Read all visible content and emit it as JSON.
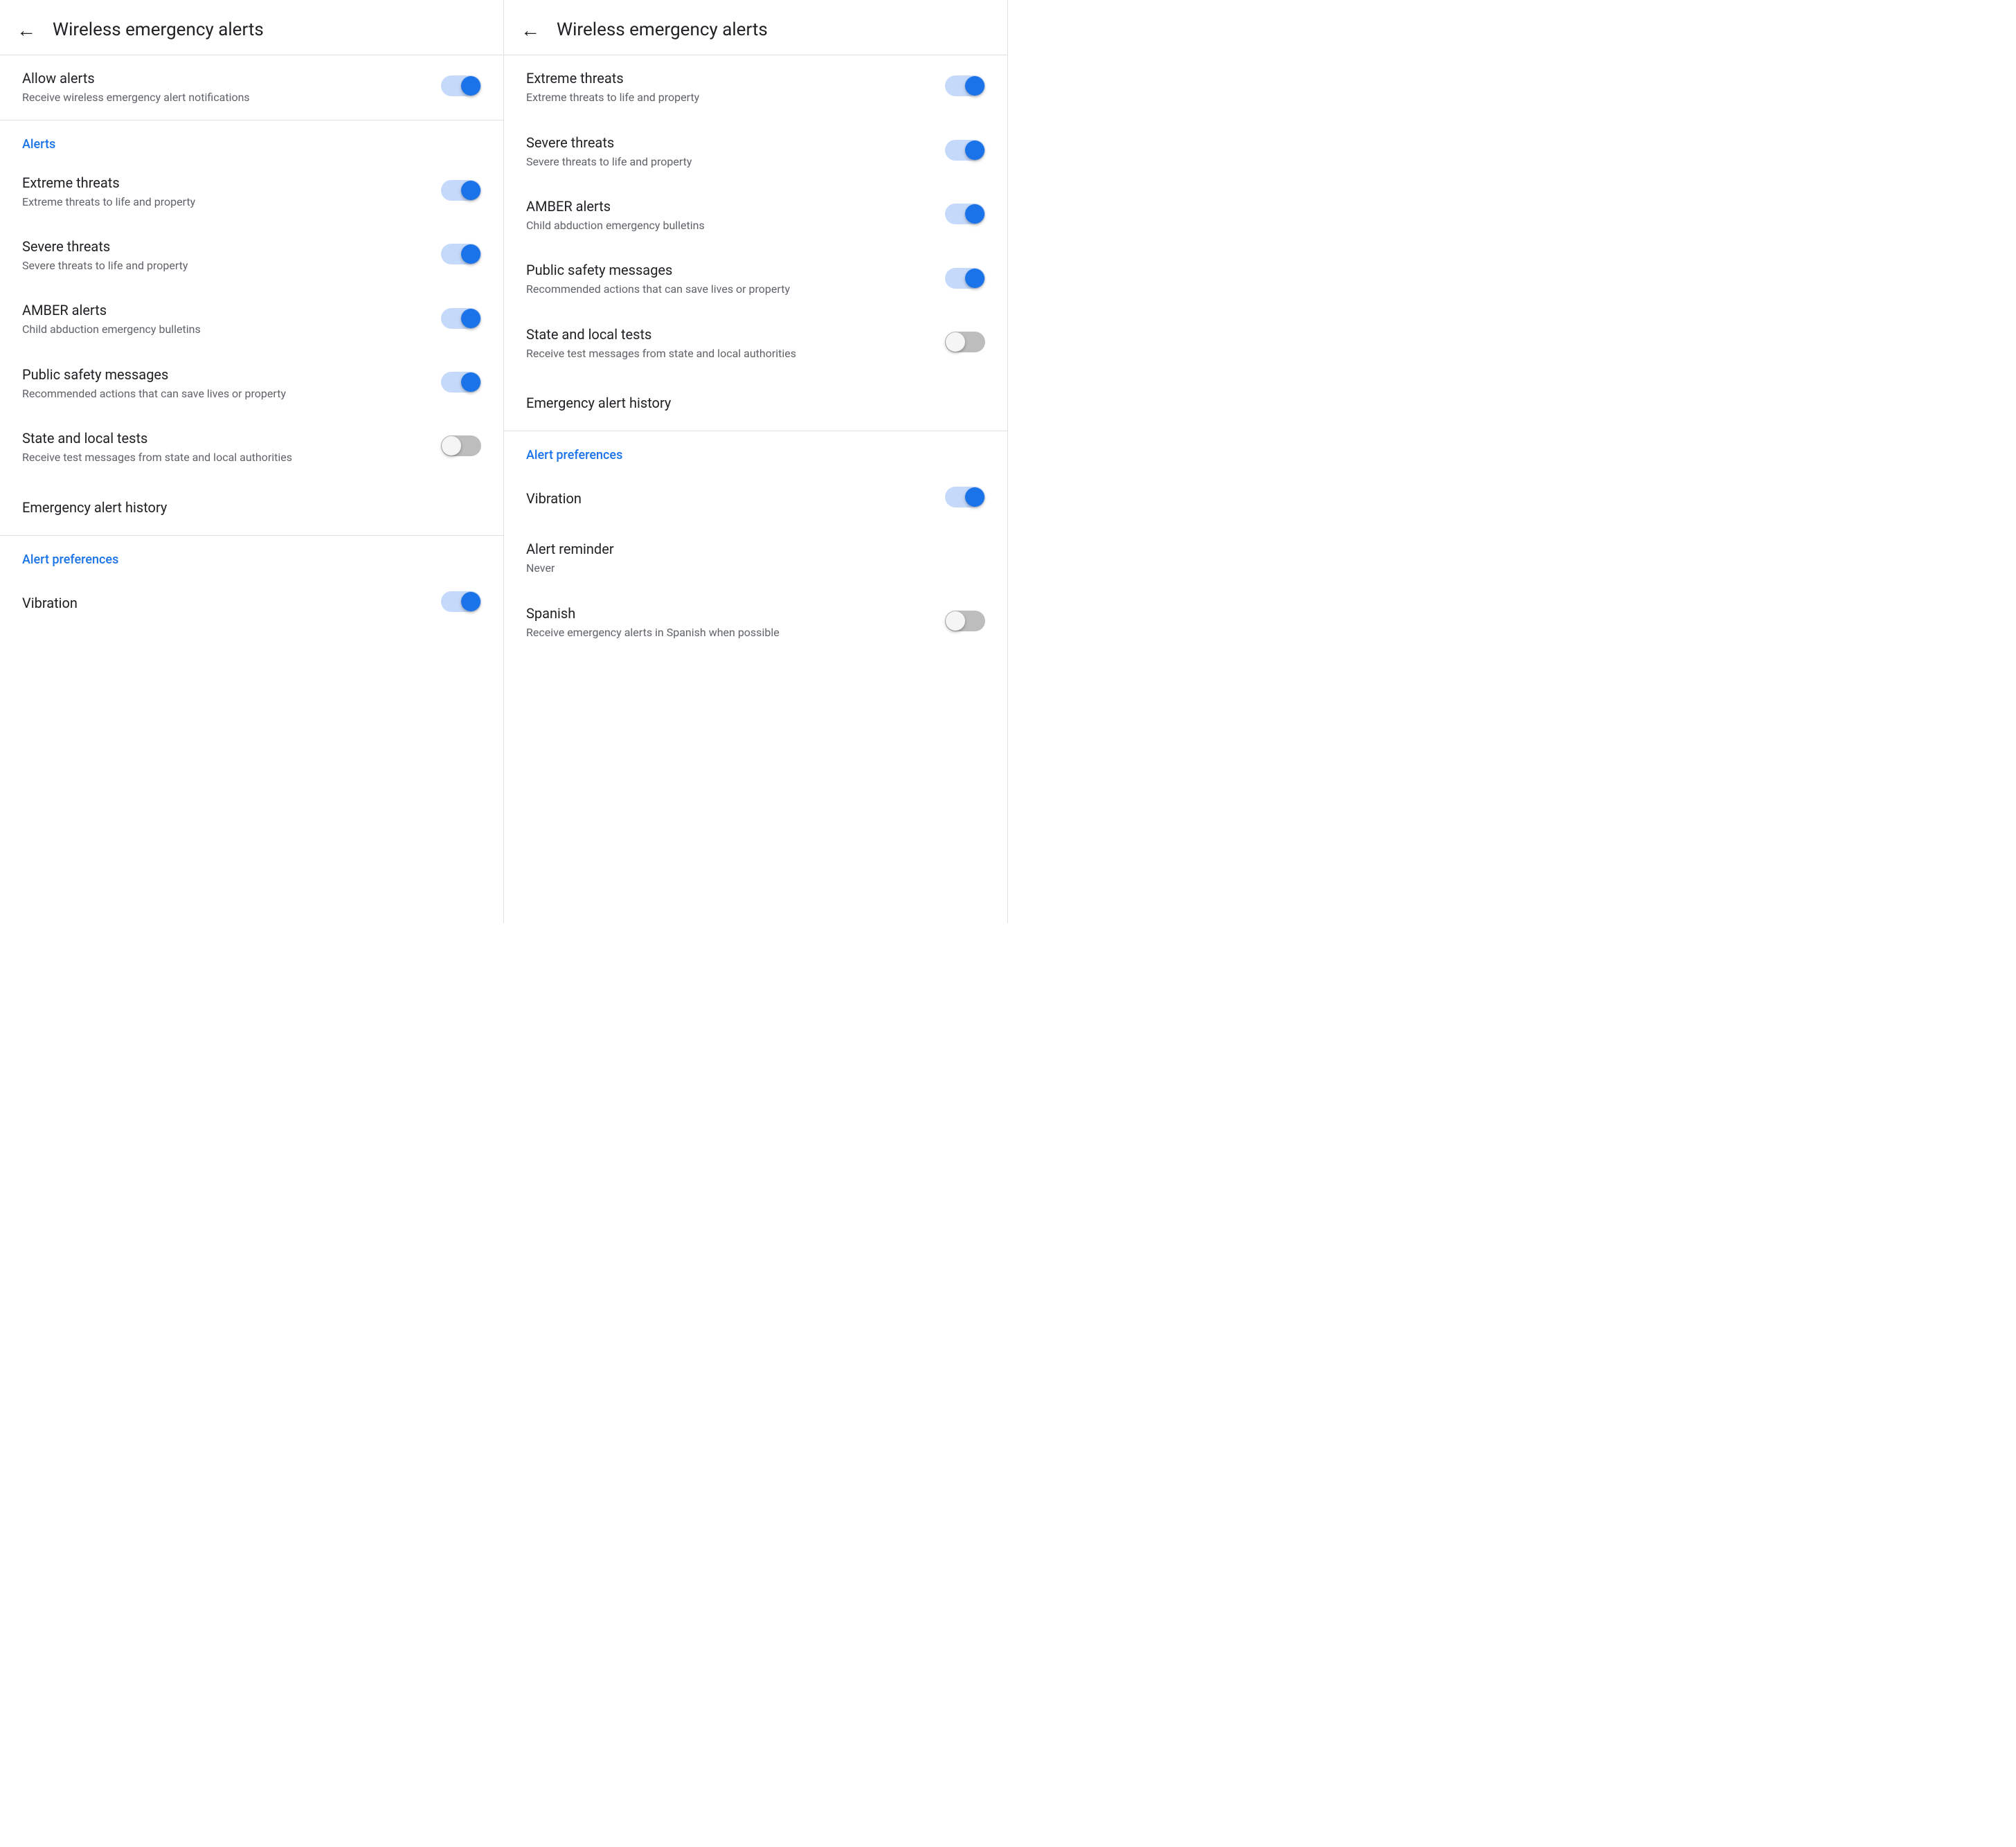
{
  "panels": [
    {
      "id": "panel-left",
      "header": {
        "back_label": "←",
        "title": "Wireless emergency alerts"
      },
      "sections": [
        {
          "id": "allow-section",
          "items": [
            {
              "id": "allow-alerts",
              "title": "Allow alerts",
              "subtitle": "Receive wireless emergency alert notifications",
              "has_toggle": true,
              "toggle_on": true
            }
          ]
        },
        {
          "id": "alerts-section",
          "label": "Alerts",
          "items": [
            {
              "id": "extreme-threats",
              "title": "Extreme threats",
              "subtitle": "Extreme threats to life and property",
              "has_toggle": true,
              "toggle_on": true
            },
            {
              "id": "severe-threats",
              "title": "Severe threats",
              "subtitle": "Severe threats to life and property",
              "has_toggle": true,
              "toggle_on": true
            },
            {
              "id": "amber-alerts",
              "title": "AMBER alerts",
              "subtitle": "Child abduction emergency bulletins",
              "has_toggle": true,
              "toggle_on": true
            },
            {
              "id": "public-safety",
              "title": "Public safety messages",
              "subtitle": "Recommended actions that can save lives or property",
              "has_toggle": true,
              "toggle_on": true
            },
            {
              "id": "state-local-tests",
              "title": "State and local tests",
              "subtitle": "Receive test messages from state and local authorities",
              "has_toggle": true,
              "toggle_on": false
            },
            {
              "id": "emergency-history",
              "title": "Emergency alert history",
              "subtitle": "",
              "has_toggle": false,
              "toggle_on": false
            }
          ]
        },
        {
          "id": "preferences-section",
          "label": "Alert preferences",
          "items": [
            {
              "id": "vibration",
              "title": "Vibration",
              "subtitle": "",
              "has_toggle": true,
              "toggle_on": true
            }
          ]
        }
      ]
    },
    {
      "id": "panel-right",
      "header": {
        "back_label": "←",
        "title": "Wireless emergency alerts"
      },
      "sections": [
        {
          "id": "alerts-section-r",
          "label": "",
          "items": [
            {
              "id": "extreme-threats-r",
              "title": "Extreme threats",
              "subtitle": "Extreme threats to life and property",
              "has_toggle": true,
              "toggle_on": true
            },
            {
              "id": "severe-threats-r",
              "title": "Severe threats",
              "subtitle": "Severe threats to life and property",
              "has_toggle": true,
              "toggle_on": true
            },
            {
              "id": "amber-alerts-r",
              "title": "AMBER alerts",
              "subtitle": "Child abduction emergency bulletins",
              "has_toggle": true,
              "toggle_on": true
            },
            {
              "id": "public-safety-r",
              "title": "Public safety messages",
              "subtitle": "Recommended actions that can save lives or property",
              "has_toggle": true,
              "toggle_on": true
            },
            {
              "id": "state-local-tests-r",
              "title": "State and local tests",
              "subtitle": "Receive test messages from state and local authorities",
              "has_toggle": true,
              "toggle_on": false
            },
            {
              "id": "emergency-history-r",
              "title": "Emergency alert history",
              "subtitle": "",
              "has_toggle": false,
              "toggle_on": false
            }
          ]
        },
        {
          "id": "preferences-section-r",
          "label": "Alert preferences",
          "items": [
            {
              "id": "vibration-r",
              "title": "Vibration",
              "subtitle": "",
              "has_toggle": true,
              "toggle_on": true
            },
            {
              "id": "alert-reminder-r",
              "title": "Alert reminder",
              "subtitle": "Never",
              "has_toggle": false,
              "toggle_on": false
            },
            {
              "id": "spanish-r",
              "title": "Spanish",
              "subtitle": "Receive emergency alerts in Spanish when possible",
              "has_toggle": true,
              "toggle_on": false
            }
          ]
        }
      ]
    }
  ]
}
